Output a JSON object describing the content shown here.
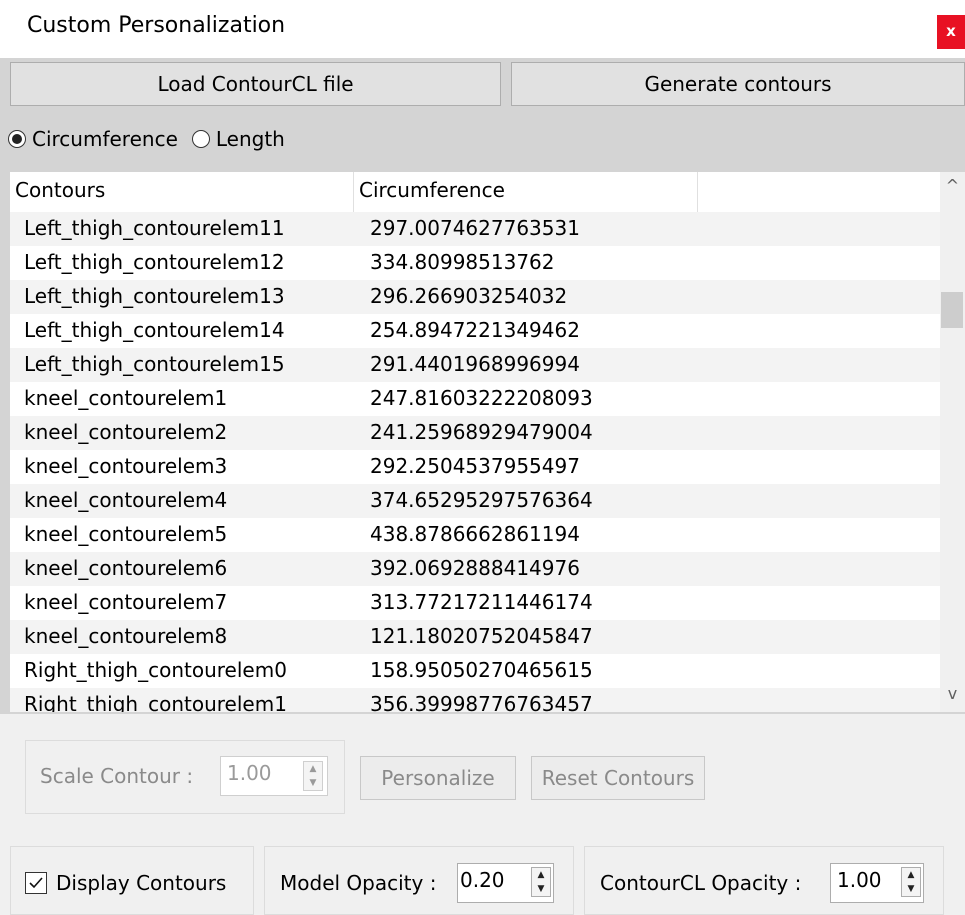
{
  "window": {
    "title": "Custom Personalization",
    "close_label": "x"
  },
  "toolbar": {
    "load_label": "Load ContourCL file",
    "generate_label": "Generate contours"
  },
  "mode": {
    "circumference_label": "Circumference",
    "length_label": "Length",
    "selected": "Circumference"
  },
  "table": {
    "columns": [
      "Contours",
      "Circumference",
      ""
    ],
    "rows": [
      [
        "Left_thigh_contourelem11",
        "297.0074627763531"
      ],
      [
        "Left_thigh_contourelem12",
        "334.80998513762"
      ],
      [
        "Left_thigh_contourelem13",
        "296.266903254032"
      ],
      [
        "Left_thigh_contourelem14",
        "254.8947221349462"
      ],
      [
        "Left_thigh_contourelem15",
        "291.4401968996994"
      ],
      [
        "kneel_contourelem1",
        "247.81603222208093"
      ],
      [
        "kneel_contourelem2",
        "241.25968929479004"
      ],
      [
        "kneel_contourelem3",
        "292.2504537955497"
      ],
      [
        "kneel_contourelem4",
        "374.65295297576364"
      ],
      [
        "kneel_contourelem5",
        "438.8786662861194"
      ],
      [
        "kneel_contourelem6",
        "392.0692888414976"
      ],
      [
        "kneel_contourelem7",
        "313.77217211446174"
      ],
      [
        "kneel_contourelem8",
        "121.18020752045847"
      ],
      [
        "Right_thigh_contourelem0",
        "158.95050270465615"
      ],
      [
        "Right_thigh_contourelem1",
        "356.39998776763457"
      ]
    ]
  },
  "scale": {
    "label": "Scale Contour :",
    "value": "1.00",
    "personalize_label": "Personalize",
    "reset_label": "Reset Contours"
  },
  "display": {
    "checkbox_label": "Display Contours",
    "checked": true,
    "model_opacity_label": "Model Opacity :",
    "model_opacity_value": "0.20",
    "contourcl_opacity_label": "ContourCL Opacity :",
    "contourcl_opacity_value": "1.00"
  }
}
